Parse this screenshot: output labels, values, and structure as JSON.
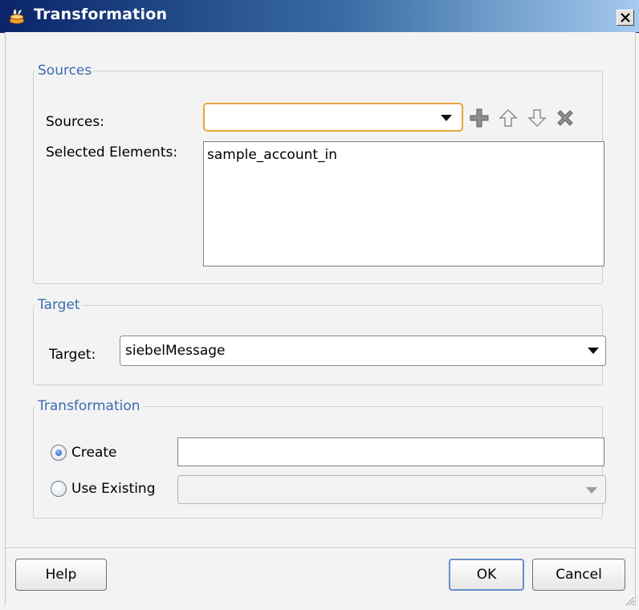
{
  "window": {
    "title": "Transformation"
  },
  "sources_group": {
    "legend": "Sources",
    "sources_label": "Sources:",
    "sources_value": "",
    "selected_label": "Selected Elements:",
    "selected_items": [
      "sample_account_in"
    ]
  },
  "target_group": {
    "legend": "Target",
    "target_label": "Target:",
    "target_value": "siebelMessage"
  },
  "transformation_group": {
    "legend": "Transformation",
    "create_label": "Create",
    "create_value": "",
    "create_selected": true,
    "use_existing_label": "Use Existing",
    "use_existing_value": "",
    "use_existing_selected": false
  },
  "footer": {
    "help_label": "Help",
    "ok_label": "OK",
    "cancel_label": "Cancel"
  },
  "icons": [
    "add-icon",
    "move-up-icon",
    "move-down-icon",
    "remove-icon",
    "close-icon",
    "app-icon"
  ]
}
